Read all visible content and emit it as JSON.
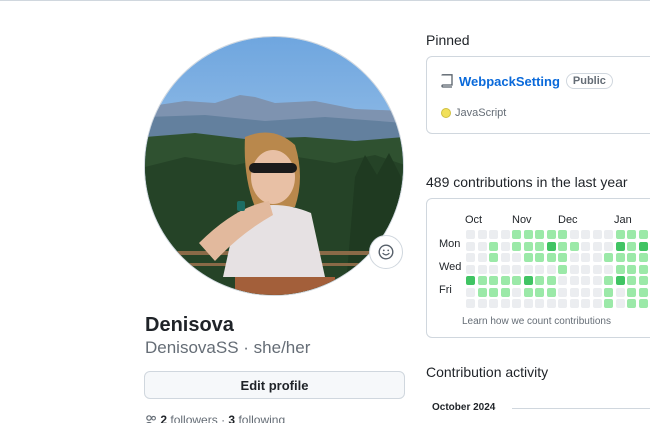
{
  "profile": {
    "name": "Denisova",
    "login_line": "DenisovaSS · she/her",
    "edit_button": "Edit profile",
    "followers_count": "2",
    "followers_label": "followers",
    "following_count": "3",
    "following_label": "following"
  },
  "icons": {
    "status": "smiley-icon",
    "repo": "book-icon",
    "people": "people-icon"
  },
  "pinned": {
    "title": "Pinned",
    "repo_name": "WebpackSetting",
    "visibility": "Public",
    "language": "JavaScript",
    "language_color": "#f1e05a"
  },
  "contributions": {
    "summary": "489 contributions in the last year",
    "months": [
      "Oct",
      "Nov",
      "Dec",
      "Jan"
    ],
    "day_labels": [
      "Mon",
      "Wed",
      "Fri"
    ],
    "learn_link": "Learn how we count contributions",
    "palette": [
      "#ebedf0",
      "#9be9a8",
      "#40c463",
      "#30a14e",
      "#216e39"
    ],
    "levels": [
      [
        0,
        0,
        0,
        0,
        1,
        1,
        1,
        1,
        1,
        0,
        0,
        0,
        0,
        1,
        1,
        1
      ],
      [
        0,
        0,
        1,
        0,
        1,
        1,
        1,
        2,
        1,
        1,
        0,
        0,
        0,
        2,
        1,
        2
      ],
      [
        0,
        0,
        1,
        0,
        0,
        1,
        1,
        1,
        1,
        0,
        0,
        0,
        1,
        1,
        1,
        1
      ],
      [
        0,
        0,
        0,
        0,
        0,
        0,
        0,
        0,
        1,
        0,
        0,
        0,
        0,
        1,
        1,
        1
      ],
      [
        2,
        1,
        1,
        1,
        1,
        2,
        1,
        1,
        0,
        0,
        0,
        0,
        1,
        2,
        1,
        1
      ],
      [
        0,
        1,
        1,
        1,
        0,
        1,
        1,
        1,
        0,
        0,
        0,
        0,
        1,
        0,
        1,
        1
      ],
      [
        0,
        0,
        0,
        0,
        0,
        0,
        0,
        0,
        0,
        0,
        0,
        0,
        1,
        0,
        1,
        1
      ]
    ]
  },
  "activity": {
    "title": "Contribution activity",
    "month": "October 2024"
  }
}
